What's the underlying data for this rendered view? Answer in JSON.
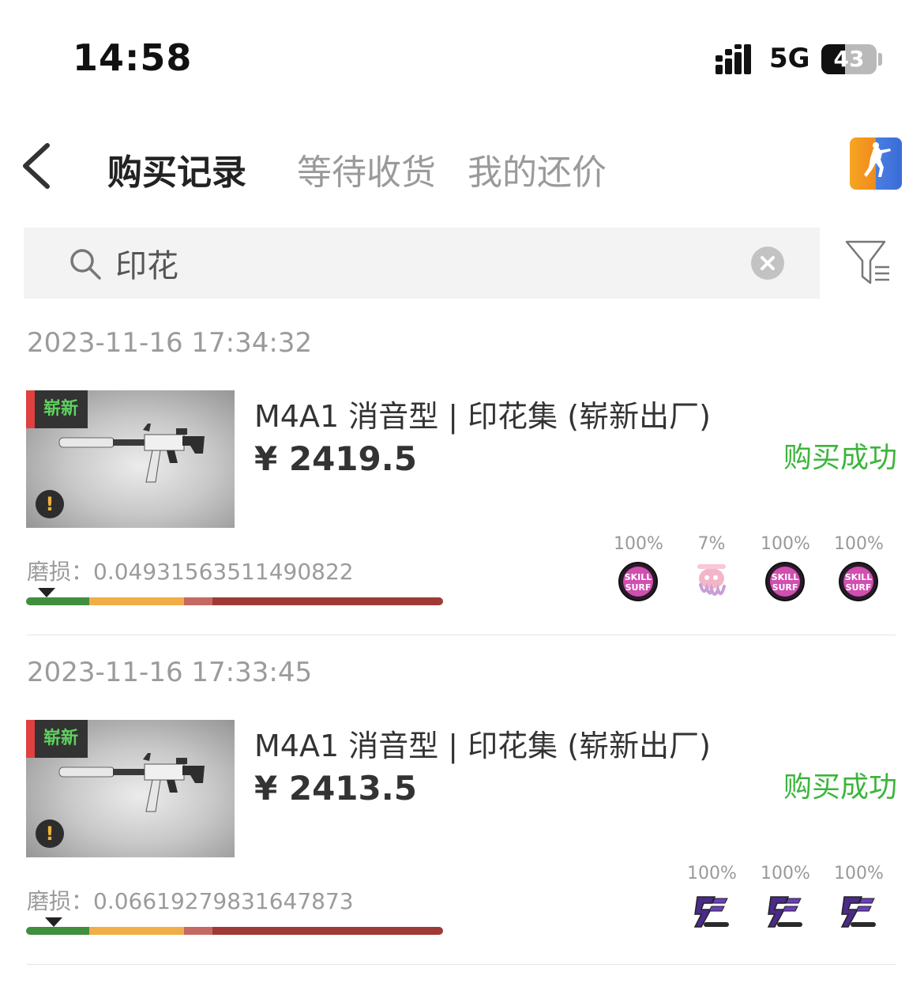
{
  "status_bar": {
    "time": "14:58",
    "network": "5G",
    "battery": "43",
    "battery_level": 0.43
  },
  "header": {
    "tabs": [
      {
        "label": "购买记录",
        "active": true
      },
      {
        "label": "等待收货",
        "active": false
      },
      {
        "label": "我的还价",
        "active": false
      }
    ],
    "game_icon": "counter-strike-icon"
  },
  "search": {
    "value": "印花",
    "placeholder": ""
  },
  "records": [
    {
      "time": "2023-11-16 17:34:32",
      "badge": "崭新",
      "name": "M4A1 消音型 | 印花集 (崭新出厂)",
      "price": "¥ 2419.5",
      "status": "购买成功",
      "wear_label": "磨损：",
      "wear_value": "0.04931563511490822",
      "wear": 0.0493,
      "stickers": [
        {
          "pct": "100%",
          "icon": "skill-surf-sticker-icon"
        },
        {
          "pct": "7%",
          "icon": "octopus-sticker-icon"
        },
        {
          "pct": "100%",
          "icon": "skill-surf-sticker-icon"
        },
        {
          "pct": "100%",
          "icon": "skill-surf-sticker-icon"
        }
      ]
    },
    {
      "time": "2023-11-16 17:33:45",
      "badge": "崭新",
      "name": "M4A1 消音型 | 印花集 (崭新出厂)",
      "price": "¥ 2413.5",
      "status": "购买成功",
      "wear_label": "磨损：",
      "wear_value": "0.06619279831647873",
      "wear": 0.0662,
      "stickers": [
        {
          "pct": "100%",
          "icon": "team-logo-sticker-icon"
        },
        {
          "pct": "100%",
          "icon": "team-logo-sticker-icon"
        },
        {
          "pct": "100%",
          "icon": "team-logo-sticker-icon"
        }
      ]
    }
  ],
  "colors": {
    "success": "#3cb53c",
    "badge_text": "#5fd15f",
    "badge_accent": "#e04040",
    "wear_fn": "#3f8f3f",
    "wear_mw": "#5aa83a",
    "wear_ft": "#f0ad48",
    "wear_ww": "#c46a62",
    "wear_bs": "#a03a36"
  }
}
